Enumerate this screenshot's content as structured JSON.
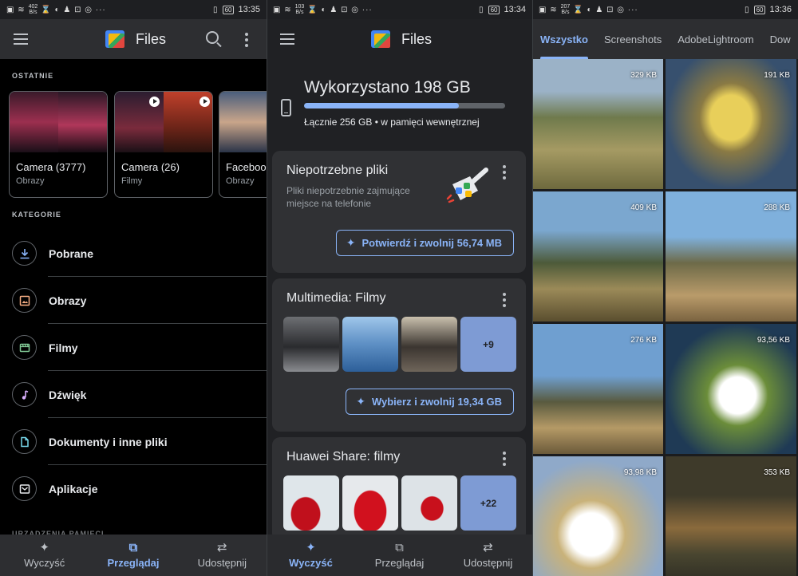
{
  "status": {
    "left": {
      "speed": "402\nB/s",
      "speed2": "103\nB/s",
      "speed3": "207\nB/s"
    },
    "battery": "60",
    "times": [
      "13:35",
      "13:34",
      "13:36"
    ]
  },
  "panel1": {
    "app_title": "Files",
    "recent_label": "OSTATNIE",
    "recent": [
      {
        "name": "Camera (3777)",
        "type": "Obrazy"
      },
      {
        "name": "Camera (26)",
        "type": "Filmy"
      },
      {
        "name": "Facebook",
        "type": "Obrazy"
      }
    ],
    "categories_label": "KATEGORIE",
    "categories": [
      {
        "label": "Pobrane",
        "icon": "download-icon",
        "color": "#8ab4f8"
      },
      {
        "label": "Obrazy",
        "icon": "image-icon",
        "color": "#f6ae84"
      },
      {
        "label": "Filmy",
        "icon": "movie-icon",
        "color": "#81c995"
      },
      {
        "label": "Dźwięk",
        "icon": "music-note-icon",
        "color": "#d7aefb"
      },
      {
        "label": "Dokumenty i inne pliki",
        "icon": "document-icon",
        "color": "#78d9ec"
      },
      {
        "label": "Aplikacje",
        "icon": "app-icon",
        "color": "#e8eaed"
      }
    ],
    "storage_label": "URZĄDZENIA PAMIĘCI",
    "nav": [
      {
        "label": "Wyczyść",
        "icon": "sparkle-icon"
      },
      {
        "label": "Przeglądaj",
        "icon": "browse-icon"
      },
      {
        "label": "Udostępnij",
        "icon": "swap-icon"
      }
    ],
    "nav_active": 1
  },
  "panel2": {
    "app_title": "Files",
    "storage": {
      "title": "Wykorzystano 198 GB",
      "subtitle": "Łącznie 256 GB • w pamięci wewnętrznej",
      "used_fraction": 0.77
    },
    "junk": {
      "title": "Niepotrzebne pliki",
      "desc": "Pliki niepotrzebnie zajmujące miejsce na telefonie",
      "button": "Potwierdź i zwolnij 56,74 MB"
    },
    "media": {
      "title": "Multimedia: Filmy",
      "more": "+9",
      "button": "Wybierz i zwolnij 19,34 GB"
    },
    "huawei": {
      "title": "Huawei Share: filmy",
      "more": "+22"
    },
    "nav": [
      {
        "label": "Wyczyść",
        "icon": "sparkle-icon"
      },
      {
        "label": "Przeglądaj",
        "icon": "browse-icon"
      },
      {
        "label": "Udostępnij",
        "icon": "swap-icon"
      }
    ],
    "nav_active": 0
  },
  "panel3": {
    "tabs": [
      "Wszystko",
      "Screenshots",
      "AdobeLightroom",
      "Dow"
    ],
    "tab_active": 0,
    "photos": [
      {
        "size": "329 KB"
      },
      {
        "size": "191 KB"
      },
      {
        "size": "409 KB"
      },
      {
        "size": "288 KB"
      },
      {
        "size": "276 KB"
      },
      {
        "size": "93,56 KB"
      },
      {
        "size": "93,98 KB"
      },
      {
        "size": "353 KB"
      }
    ]
  },
  "colors": {
    "accent": "#8ab4f8",
    "surface": "#303134",
    "background": "#202124"
  }
}
